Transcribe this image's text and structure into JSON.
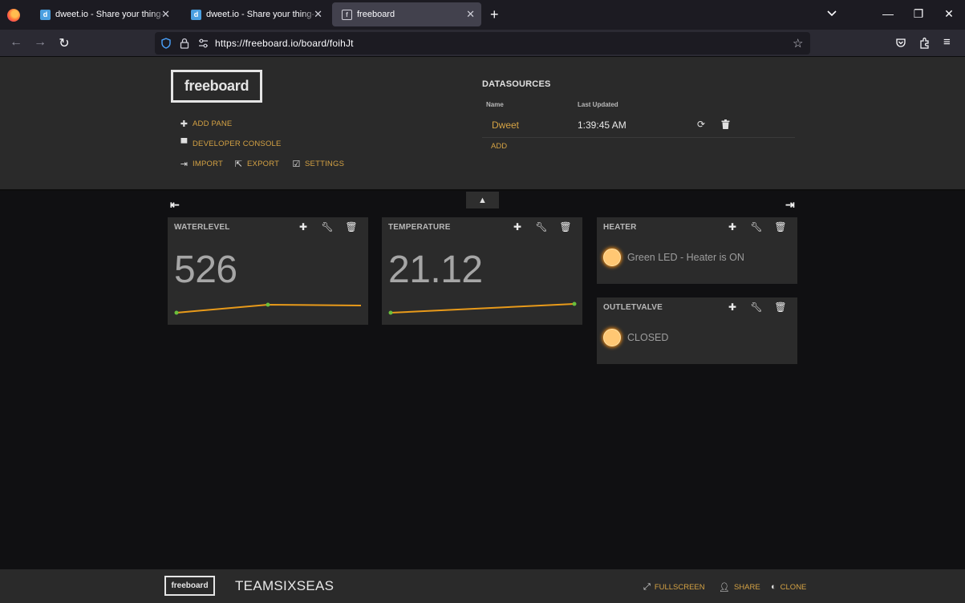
{
  "browser": {
    "tabs": [
      {
        "label": "dweet.io - Share your thing- like",
        "favicon": "d",
        "active": false
      },
      {
        "label": "dweet.io - Share your thing- like",
        "favicon": "d",
        "active": false
      },
      {
        "label": "freeboard",
        "favicon": "f",
        "active": true
      }
    ],
    "new_tab": "+",
    "url": "https://freeboard.io/board/foihJt",
    "window": {
      "minimize": "—",
      "restore": "❐",
      "close": "✕"
    }
  },
  "header": {
    "logo": "freeboard",
    "actions": {
      "add_pane": "ADD PANE",
      "developer_console": "DEVELOPER CONSOLE",
      "import": "IMPORT",
      "export": "EXPORT",
      "settings": "SETTINGS"
    },
    "datasources": {
      "title": "DATASOURCES",
      "col_name": "Name",
      "col_updated": "Last Updated",
      "rows": [
        {
          "name": "Dweet",
          "updated": "1:39:45 AM"
        }
      ],
      "add": "ADD"
    }
  },
  "panes": {
    "waterlevel": {
      "title": "WATERLEVEL",
      "value": "526"
    },
    "temperature": {
      "title": "TEMPERATURE",
      "value": "21.12"
    },
    "heater": {
      "title": "HEATER",
      "text": "Green LED - Heater is ON"
    },
    "outletvalve": {
      "title": "OUTLETVALVE",
      "text": "CLOSED"
    }
  },
  "colors": {
    "accent": "#d4a244",
    "sparkline": "#e89a1a",
    "indicator": "#ffc773",
    "spark_point": "#6abf3c"
  },
  "footer": {
    "logo": "freeboard",
    "board_title": "TEAMSIXSEAS",
    "fullscreen": "FULLSCREEN",
    "share": "SHARE",
    "clone": "CLONE"
  }
}
